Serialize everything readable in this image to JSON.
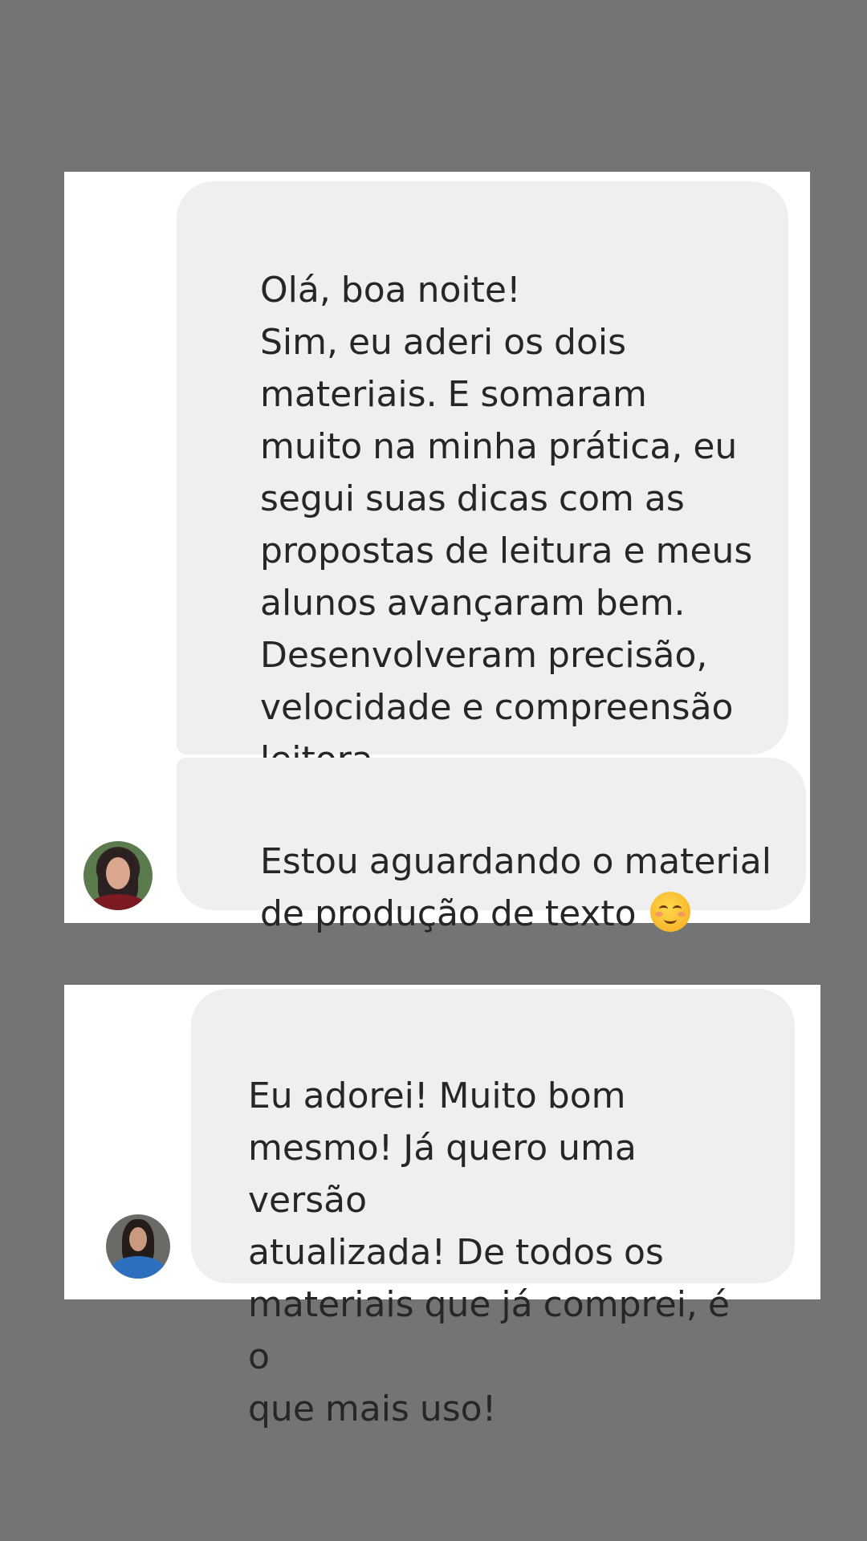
{
  "messages": [
    {
      "sender": "user-1",
      "bubbles": [
        "Olá, boa noite!\nSim, eu aderi os dois\nmateriais. E somaram\nmuito na minha prática, eu\nsegui suas dicas com as\npropostas de leitura e meus\nalunos avançaram bem.\nDesenvolveram precisão,\nvelocidade e compreensão\nleitora.",
        "Estou aguardando o material\nde produção de texto"
      ],
      "emoji": "smiling-face-with-blush"
    },
    {
      "sender": "user-2",
      "bubbles": [
        "Eu adorei! Muito bom\nmesmo! Já quero uma versão\natualizada! De todos os\nmateriais que já comprei, é o\nque mais uso!"
      ]
    }
  ],
  "colors": {
    "background": "#747474",
    "card": "#ffffff",
    "bubble": "#efefef",
    "text": "#262626"
  }
}
